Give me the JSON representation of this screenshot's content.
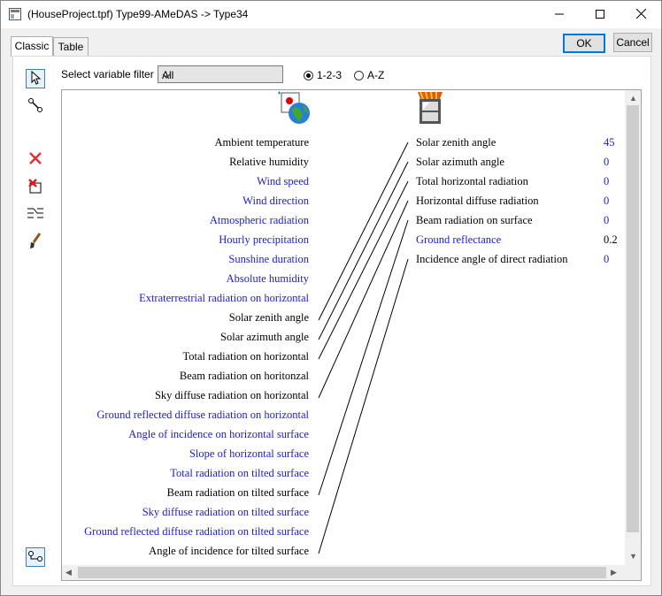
{
  "window": {
    "title": "(HouseProject.tpf) Type99-AMeDAS -> Type34"
  },
  "tabs": [
    {
      "label": "Classic"
    },
    {
      "label": "Table"
    }
  ],
  "buttons": {
    "ok": "OK",
    "cancel": "Cancel"
  },
  "filter": {
    "label": "Select variable filter :",
    "value": "All"
  },
  "sort": {
    "option1": "1-2-3",
    "option2": "A-Z",
    "selected": "1-2-3"
  },
  "outputs": [
    {
      "label": "Ambient temperature",
      "connected": true
    },
    {
      "label": "Relative humidity",
      "connected": true
    },
    {
      "label": "Wind speed",
      "connected": false
    },
    {
      "label": "Wind direction",
      "connected": false
    },
    {
      "label": "Atmospheric radiation",
      "connected": false
    },
    {
      "label": "Hourly precipitation",
      "connected": false
    },
    {
      "label": "Sunshine duration",
      "connected": false
    },
    {
      "label": "Absolute humidity",
      "connected": false
    },
    {
      "label": "Extraterrestrial radiation on horizontal",
      "connected": false
    },
    {
      "label": "Solar zenith angle",
      "connected": true
    },
    {
      "label": "Solar azimuth angle",
      "connected": true
    },
    {
      "label": "Total radiation on horizontal",
      "connected": true
    },
    {
      "label": "Beam radiation on horitonzal",
      "connected": true
    },
    {
      "label": "Sky diffuse radiation on horizontal",
      "connected": true
    },
    {
      "label": "Ground reflected diffuse radiation on horizontal",
      "connected": false
    },
    {
      "label": "Angle of incidence on horizontal surface",
      "connected": false
    },
    {
      "label": "Slope of horizontal surface",
      "connected": false
    },
    {
      "label": "Total radiation on tilted surface",
      "connected": false
    },
    {
      "label": "Beam radiation on tilted surface",
      "connected": true
    },
    {
      "label": "Sky diffuse radiation on tilted surface",
      "connected": false
    },
    {
      "label": "Ground reflected diffuse radiation on tilted surface",
      "connected": false
    },
    {
      "label": "Angle of incidence for tilted surface",
      "connected": true
    }
  ],
  "inputs": [
    {
      "label": "Solar zenith angle",
      "connected": true,
      "value": "45",
      "value_color": "blue"
    },
    {
      "label": "Solar azimuth angle",
      "connected": true,
      "value": "0",
      "value_color": "blue"
    },
    {
      "label": "Total horizontal radiation",
      "connected": true,
      "value": "0",
      "value_color": "blue"
    },
    {
      "label": "Horizontal diffuse radiation",
      "connected": true,
      "value": "0",
      "value_color": "blue"
    },
    {
      "label": "Beam radiation on surface",
      "connected": true,
      "value": "0",
      "value_color": "blue"
    },
    {
      "label": "Ground reflectance",
      "connected": false,
      "value": "0.2",
      "value_color": "black"
    },
    {
      "label": "Incidence angle of direct radiation",
      "connected": true,
      "value": "0",
      "value_color": "blue"
    }
  ],
  "connections": [
    {
      "from": "Solar zenith angle",
      "to": "Solar zenith angle"
    },
    {
      "from": "Solar azimuth angle",
      "to": "Solar azimuth angle"
    },
    {
      "from": "Total radiation on horizontal",
      "to": "Total horizontal radiation"
    },
    {
      "from": "Sky diffuse radiation on horizontal",
      "to": "Horizontal diffuse radiation"
    },
    {
      "from": "Beam radiation on tilted surface",
      "to": "Beam radiation on surface"
    },
    {
      "from": "Angle of incidence for tilted surface",
      "to": "Incidence angle of direct radiation"
    }
  ],
  "colors": {
    "linked": "#000000",
    "unlinked": "#1c1ccf",
    "accent": "#0078d7"
  },
  "icons": {
    "app": "app-icon",
    "minimize": "minimize-icon",
    "maximize": "maximize-icon",
    "close": "close-icon",
    "tools": [
      "pointer-tool-icon",
      "link-tool-icon",
      "delete-link-icon",
      "delete-all-links-icon",
      "auto-link-icon",
      "paint-brush-icon",
      "connect-mode-icon"
    ],
    "source": "weather-data-icon",
    "target": "window-radiation-icon"
  }
}
